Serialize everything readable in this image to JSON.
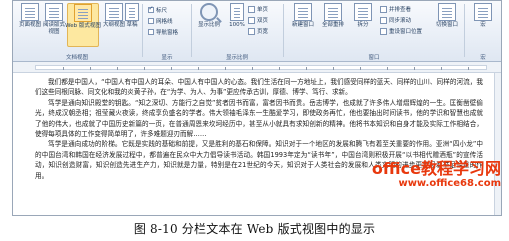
{
  "ribbon": {
    "doc_views": {
      "group_label": "文档视图",
      "buttons": [
        {
          "label": "页面视图",
          "active": false
        },
        {
          "label": "阅读版式\n视图",
          "active": false
        },
        {
          "label": "Web 版式视图",
          "active": true
        },
        {
          "label": "大纲视图",
          "active": false
        },
        {
          "label": "草稿",
          "active": false
        }
      ]
    },
    "show": {
      "group_label": "显示",
      "items": [
        {
          "label": "标尺",
          "checked": true
        },
        {
          "label": "网格线",
          "checked": false
        },
        {
          "label": "导航窗格",
          "checked": false
        }
      ]
    },
    "zoom": {
      "group_label": "显示比例",
      "zoom_label": "显示比例",
      "zoom_100": "100%",
      "items": [
        "单页",
        "双页",
        "页宽"
      ]
    },
    "window": {
      "group_label": "窗口",
      "buttons": [
        "新建窗口",
        "全部重排",
        "拆分"
      ],
      "items": [
        "并排查看",
        "同步滚动",
        "重设窗口位置"
      ],
      "switch_label": "切换窗口"
    },
    "macro": {
      "group_label": "宏",
      "label": "宏"
    }
  },
  "document": {
    "paragraphs": [
      "我们都是中国人，“中国人有中国人的耳朵、中国人有中国人的心态。我们生活在同一方地址上，我们感受同样的蓝天、同样的山川、同样的河流，我们这些同根同脉、同文化和我的炎黄子孙，在“为学、为人、为事”更应传承古训，厚德、博学、笃行、求新。",
      "笃学是通向知识殿堂的钥匙。“知之深切、方能行之自觉”贫者因书而富，富者因书而贵。岳志博学，也成就了许多伟人增熠辉煌的一生。匡衡凿壁偷光，终成汉朝丞相；祖莹藏火夜读，终成享负盛名的学者。伟大领袖毛泽东一生酷爱学习，即使政务再忙，他也要抽出时间读书，他的学识和智慧也成就了他的伟大，也成就了中国历史新篇的一页，在普通周恩来坎坷经历中，甚至从小就具有求知创新的精神。他将书本知识和自身才能及实际工作相结合，使得每项具体的工作变得简单明了，许多难题迎刃而解……",
      "笃学是通向成功的阶梯。它既是实践的基础和前提，又是胜利的基石和保障。知识对于一个地区的发展和腾飞有着至关重要的作用。亚洲“四小龙”中的中国台湾和韩国在经济发展过程中，都普遍在民众中大力倡导读书活动。韩国1993年定为“读书年”，中国台湾则积极开展“以书相代赠酒瓶”的宣传活动，知识创造财富，知识创造先进生产力，知识就是力量，特别是在21世纪的今天，知识对于人类社会的发展和人类文明的进步更是起着举足轻重的作用。"
    ]
  },
  "caption": "图 8-10 分栏文本在 Web 版式视图中的显示",
  "watermark": {
    "title": "office教程学习网",
    "url": "www.office68.com"
  },
  "colors": {
    "watermark": "#e8380d",
    "ribbon_bg": "#dfe7f2",
    "active_button": "#fde8a0"
  }
}
